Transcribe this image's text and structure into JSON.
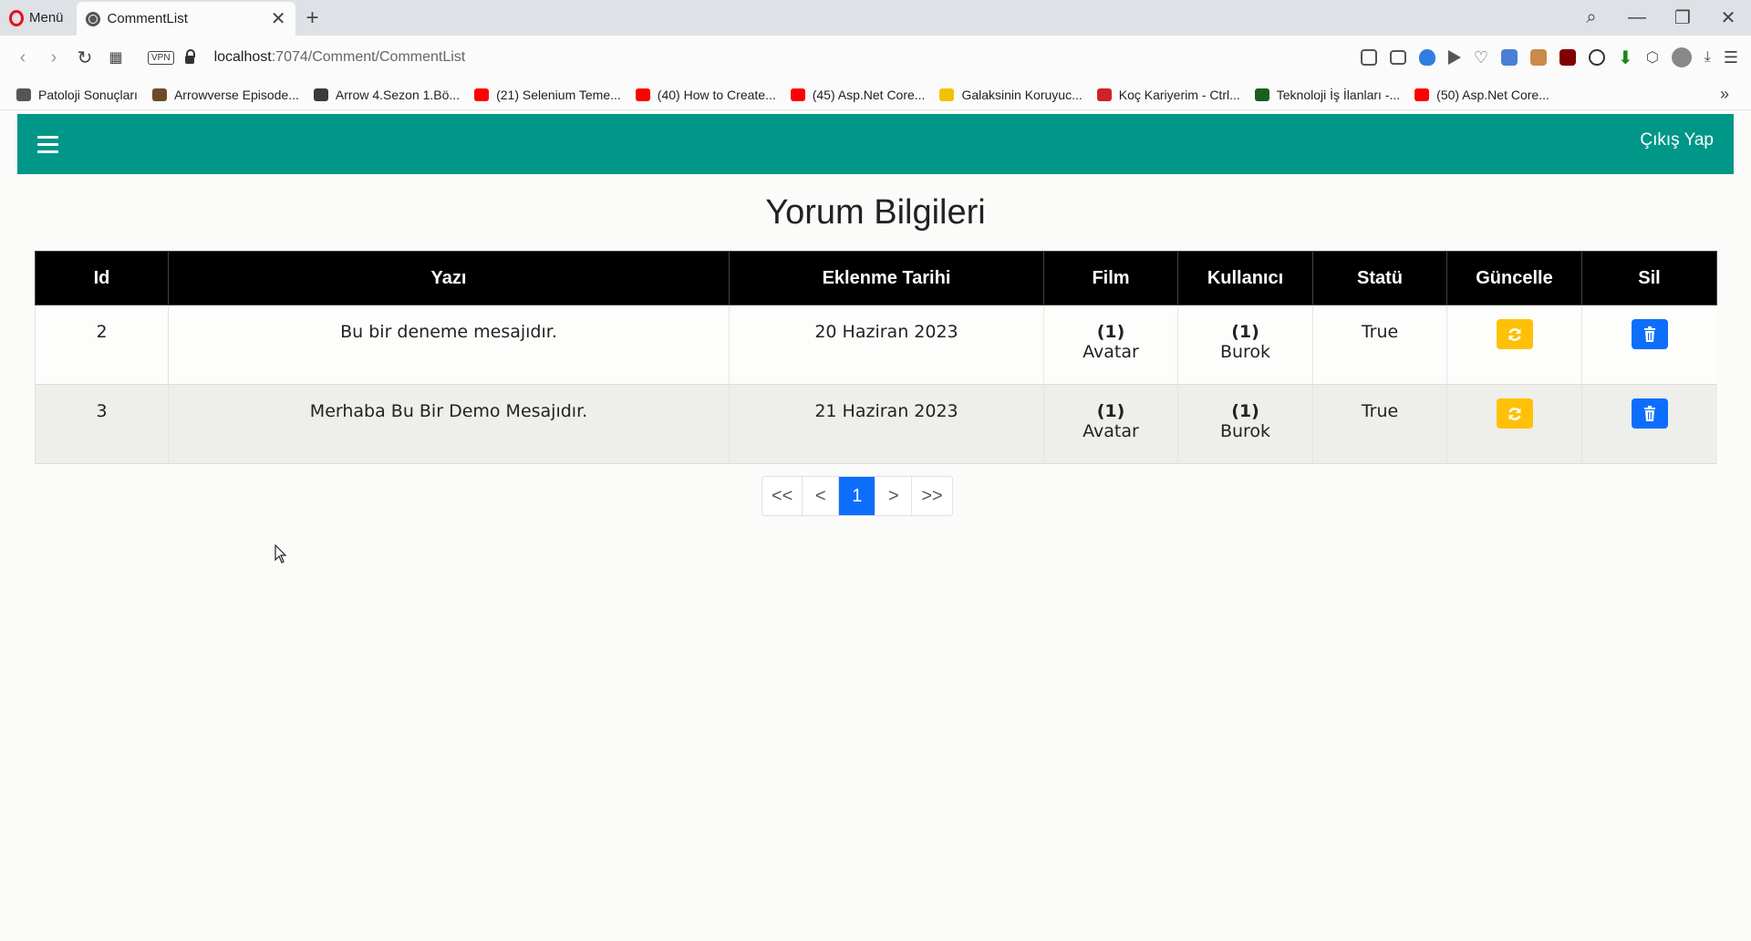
{
  "browser": {
    "menu_label": "Menü",
    "tab_title": "CommentList",
    "url_host": "localhost",
    "url_path": ":7074/Comment/CommentList",
    "vpn_label": "VPN",
    "bookmarks": [
      {
        "label": "Patoloji Sonuçları",
        "color": "#555555"
      },
      {
        "label": "Arrowverse Episode...",
        "color": "#6b4a2a"
      },
      {
        "label": "Arrow 4.Sezon 1.Bö...",
        "color": "#3a3a3a"
      },
      {
        "label": "(21) Selenium Teme...",
        "color": "#ff0000"
      },
      {
        "label": "(40) How to Create...",
        "color": "#ff0000"
      },
      {
        "label": "(45) Asp.Net Core...",
        "color": "#ff0000"
      },
      {
        "label": "Galaksinin Koruyuc...",
        "color": "#f2c200"
      },
      {
        "label": "Koç Kariyerim - Ctrl...",
        "color": "#d0202a"
      },
      {
        "label": "Teknoloji İş İlanları -...",
        "color": "#1b5e20"
      },
      {
        "label": "(50) Asp.Net Core...",
        "color": "#ff0000"
      }
    ]
  },
  "navbar": {
    "logout_label": "Çıkış Yap",
    "color": "#009688"
  },
  "page": {
    "title": "Yorum Bilgileri"
  },
  "table": {
    "headers": [
      "Id",
      "Yazı",
      "Eklenme Tarihi",
      "Film",
      "Kullanıcı",
      "Statü",
      "Güncelle",
      "Sil"
    ],
    "rows": [
      {
        "id": "2",
        "text": "Bu bir deneme mesajıdır.",
        "date": "20 Haziran 2023",
        "film_id": "(1)",
        "film_name": "Avatar",
        "user_id": "(1)",
        "user_name": "Burok",
        "status": "True"
      },
      {
        "id": "3",
        "text": "Merhaba Bu Bir Demo Mesajıdır.",
        "date": "21 Haziran 2023",
        "film_id": "(1)",
        "film_name": "Avatar",
        "user_id": "(1)",
        "user_name": "Burok",
        "status": "True"
      }
    ]
  },
  "pagination": {
    "first": "<<",
    "prev": "<",
    "current": "1",
    "next": ">",
    "last": ">>"
  },
  "colors": {
    "update_button": "#ffc107",
    "delete_button": "#0d6efd"
  }
}
